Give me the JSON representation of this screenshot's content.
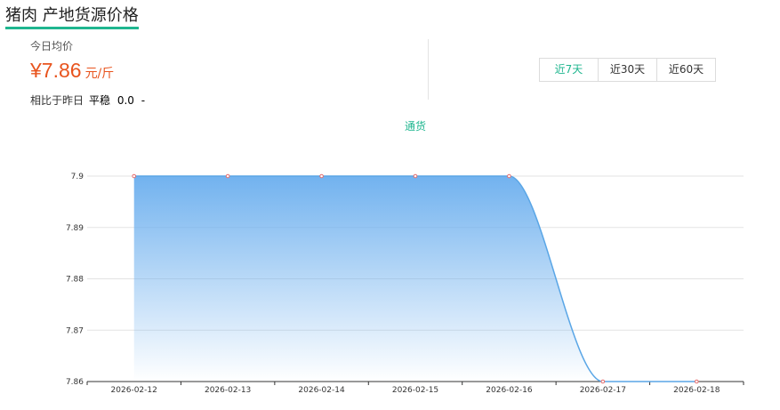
{
  "page_title": "猪肉 产地货源价格",
  "price_panel": {
    "today_label": "今日均价",
    "price": "¥7.86",
    "unit": "元/斤",
    "compare_label": "相比于昨日",
    "compare_status": "平稳",
    "compare_value": "0.0",
    "compare_trend": "-"
  },
  "range_tabs": [
    {
      "label": "近7天",
      "active": true
    },
    {
      "label": "近30天",
      "active": false
    },
    {
      "label": "近60天",
      "active": false
    }
  ],
  "colors": {
    "accent": "#1fb68f",
    "price": "#e8541e",
    "series_line": "#5aa6e6",
    "area_top": "#6aaeee"
  },
  "chart_data": {
    "type": "area",
    "x": [
      "2026-02-12",
      "2026-02-13",
      "2026-02-14",
      "2026-02-15",
      "2026-02-16",
      "2026-02-17",
      "2026-02-18"
    ],
    "series": [
      {
        "name": "通货",
        "values": [
          7.9,
          7.9,
          7.9,
          7.9,
          7.9,
          7.86,
          7.86
        ]
      }
    ],
    "yticks": [
      "7.86",
      "7.87",
      "7.88",
      "7.89",
      "7.9"
    ],
    "ylim": [
      7.86,
      7.9
    ],
    "smooth": true,
    "grid": true,
    "legend_position": "top-center"
  }
}
